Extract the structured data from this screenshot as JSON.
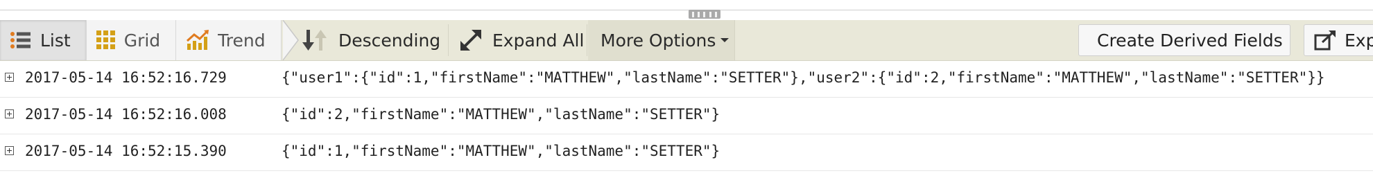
{
  "view_tabs": [
    {
      "label": "List",
      "icon": "list-icon",
      "active": true
    },
    {
      "label": "Grid",
      "icon": "grid-icon",
      "active": false
    },
    {
      "label": "Trend",
      "icon": "trend-icon",
      "active": false
    }
  ],
  "toolbar": {
    "sort_label": "Descending",
    "expand_label": "Expand All",
    "more_label": "More Options",
    "derived_label": "Create Derived Fields",
    "export_label": "Exp"
  },
  "rows": [
    {
      "timestamp": "2017-05-14 16:52:16.729",
      "message": "{\"user1\":{\"id\":1,\"firstName\":\"MATTHEW\",\"lastName\":\"SETTER\"},\"user2\":{\"id\":2,\"firstName\":\"MATTHEW\",\"lastName\":\"SETTER\"}}"
    },
    {
      "timestamp": "2017-05-14 16:52:16.008",
      "message": "{\"id\":2,\"firstName\":\"MATTHEW\",\"lastName\":\"SETTER\"}"
    },
    {
      "timestamp": "2017-05-14 16:52:15.390",
      "message": "{\"id\":1,\"firstName\":\"MATTHEW\",\"lastName\":\"SETTER\"}"
    }
  ],
  "colors": {
    "toolbar_bg": "#e9e8d9",
    "grid_icon": "#d4a017",
    "trend_icon": "#e07b1f",
    "list_icon": "#e07b1f"
  }
}
